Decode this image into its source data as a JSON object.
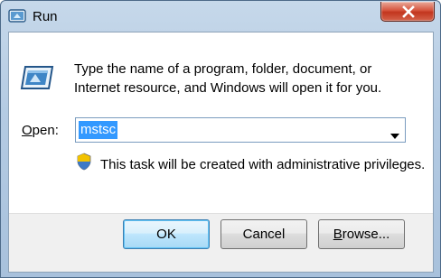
{
  "window": {
    "title": "Run"
  },
  "dialog": {
    "description": "Type the name of a program, folder, document, or Internet resource, and Windows will open it for you.",
    "open_label_accel": "O",
    "open_label_rest": "pen:",
    "open_value": "mstsc",
    "admin_notice": "This task will be created with administrative privileges."
  },
  "buttons": {
    "ok": "OK",
    "cancel": "Cancel",
    "browse_accel": "B",
    "browse_rest": "rowse..."
  },
  "colors": {
    "selection": "#3399ff",
    "close_button": "#c2351d",
    "title_bar": "#b4cbe3"
  },
  "icons": {
    "window": "run-icon",
    "close": "close-icon",
    "app": "run-app-icon",
    "dropdown": "chevron-down-icon",
    "shield": "uac-shield-icon"
  }
}
